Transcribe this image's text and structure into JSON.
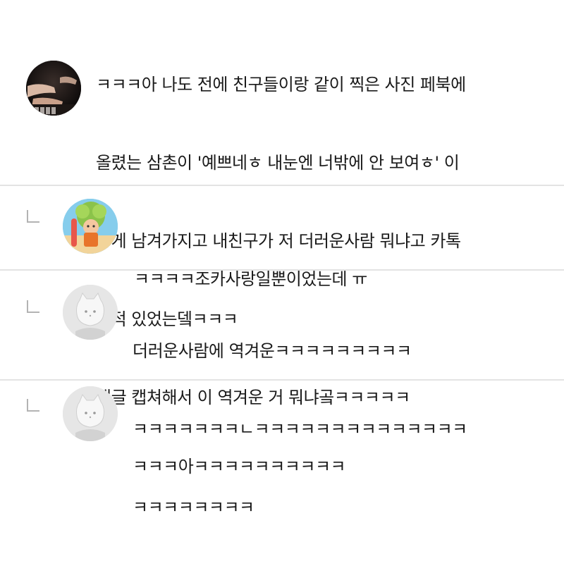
{
  "comments": [
    {
      "type": "comment",
      "lines": [
        "ㅋㅋㅋ아 나도 전에 친구들이랑 같이 찍은 사진 페북에",
        "올렸는 삼촌이 '예쁘네ㅎ 내눈엔 너밖에 안 보여ㅎ' 이",
        "렇게 남겨가지고 내친구가 저 더러운사람 뭐냐고 카톡",
        "온적 있었는뎈ㅋㅋㅋ",
        "댓글 캡쳐해서 이 역겨운 거 뭐냐곸ㅋㅋㅋㅋㅋ"
      ]
    },
    {
      "type": "reply",
      "lines": [
        "ㅋㅋㅋㅋ조카사랑일뿐이었는데 ㅠ"
      ]
    },
    {
      "type": "reply",
      "lines": [
        "더러운사람에 역겨운ㅋㅋㅋㅋㅋㅋㅋㅋㅋ",
        "ㅋㅋㅋㅋㅋㅋㅋㄴㅋㅋㅋㅋㅋㅋㅋㅋㅋㅋㅋㅋㅋㅋ",
        "ㅋㅋㅋㅋㅋㅋㅋㅋ"
      ]
    },
    {
      "type": "reply",
      "lines": [
        "ㅋㅋㅋ아ㅋㅋㅋㅋㅋㅋㅋㅋㅋㅋ"
      ]
    }
  ]
}
